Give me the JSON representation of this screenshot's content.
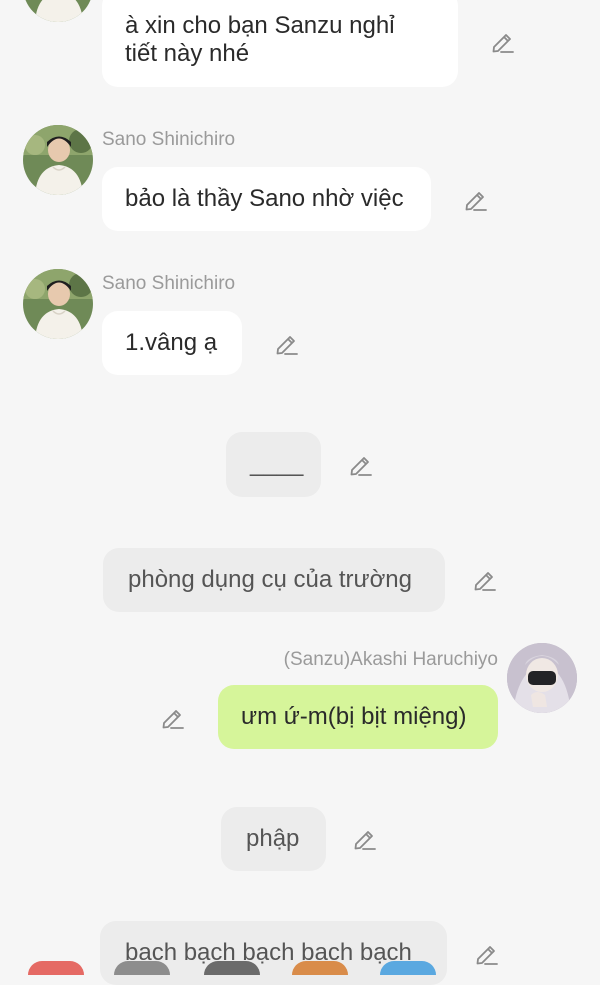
{
  "messages": [
    {
      "sender": "",
      "text": "à xin cho bạn Sanzu nghỉ\ntiết này nhé"
    },
    {
      "sender": "Sano Shinichiro",
      "text": "bảo là thầy Sano nhờ việc"
    },
    {
      "sender": "Sano Shinichiro",
      "text": "1.vâng ạ"
    },
    {
      "sender": "",
      "text": "____"
    },
    {
      "sender": "",
      "text": "phòng dụng cụ của trường"
    },
    {
      "sender": "(Sanzu)Akashi Haruchiyo",
      "text": "ưm ứ-m(bị bịt miệng)"
    },
    {
      "sender": "",
      "text": "phập"
    },
    {
      "sender": "",
      "text": "bạch bạch bạch bạch bạch"
    }
  ],
  "colors": {
    "background": "#f6f6f6",
    "bubble_white": "#ffffff",
    "bubble_gray": "#ececec",
    "bubble_green": "#d6f59a",
    "sender_text": "#9a9a9a",
    "icon": "#8a8a8a"
  },
  "icons": {
    "edit": "pencil-icon",
    "avatar_sano": "avatar-sano-shinichiro",
    "avatar_sanzu": "avatar-akashi-haruchiyo"
  }
}
